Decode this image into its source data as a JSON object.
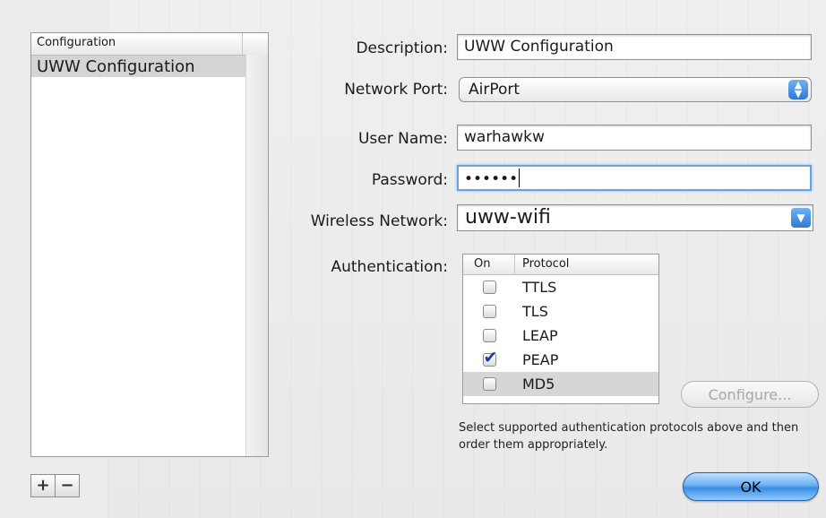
{
  "config_list": {
    "header": "Configuration",
    "items": [
      "UWW Configuration"
    ]
  },
  "list_buttons": {
    "add": "+",
    "remove": "−"
  },
  "form": {
    "description": {
      "label": "Description:",
      "value": "UWW Configuration"
    },
    "network_port": {
      "label": "Network Port:",
      "value": "AirPort"
    },
    "user_name": {
      "label": "User Name:",
      "value": "warhawkw"
    },
    "password": {
      "label": "Password:",
      "value": "••••••"
    },
    "wireless_network": {
      "label": "Wireless Network:",
      "value": "uww-wifi"
    },
    "authentication": {
      "label": "Authentication:"
    }
  },
  "auth_table": {
    "col_on": "On",
    "col_protocol": "Protocol",
    "rows": [
      {
        "protocol": "TTLS",
        "on": false
      },
      {
        "protocol": "TLS",
        "on": false
      },
      {
        "protocol": "LEAP",
        "on": false
      },
      {
        "protocol": "PEAP",
        "on": true
      },
      {
        "protocol": "MD5",
        "on": false
      }
    ]
  },
  "configure_button": "Configure...",
  "hint": "Select supported authentication protocols above and then order them appropriately.",
  "ok_button": "OK",
  "icons": {
    "popup_arrows": "up-down-arrows-icon",
    "combo_arrow": "down-arrow-icon",
    "checkmark": "checkmark-icon"
  },
  "colors": {
    "accent": "#3a8de4",
    "focus_ring": "#6aa1e0",
    "selection": "#d4d4d4"
  }
}
